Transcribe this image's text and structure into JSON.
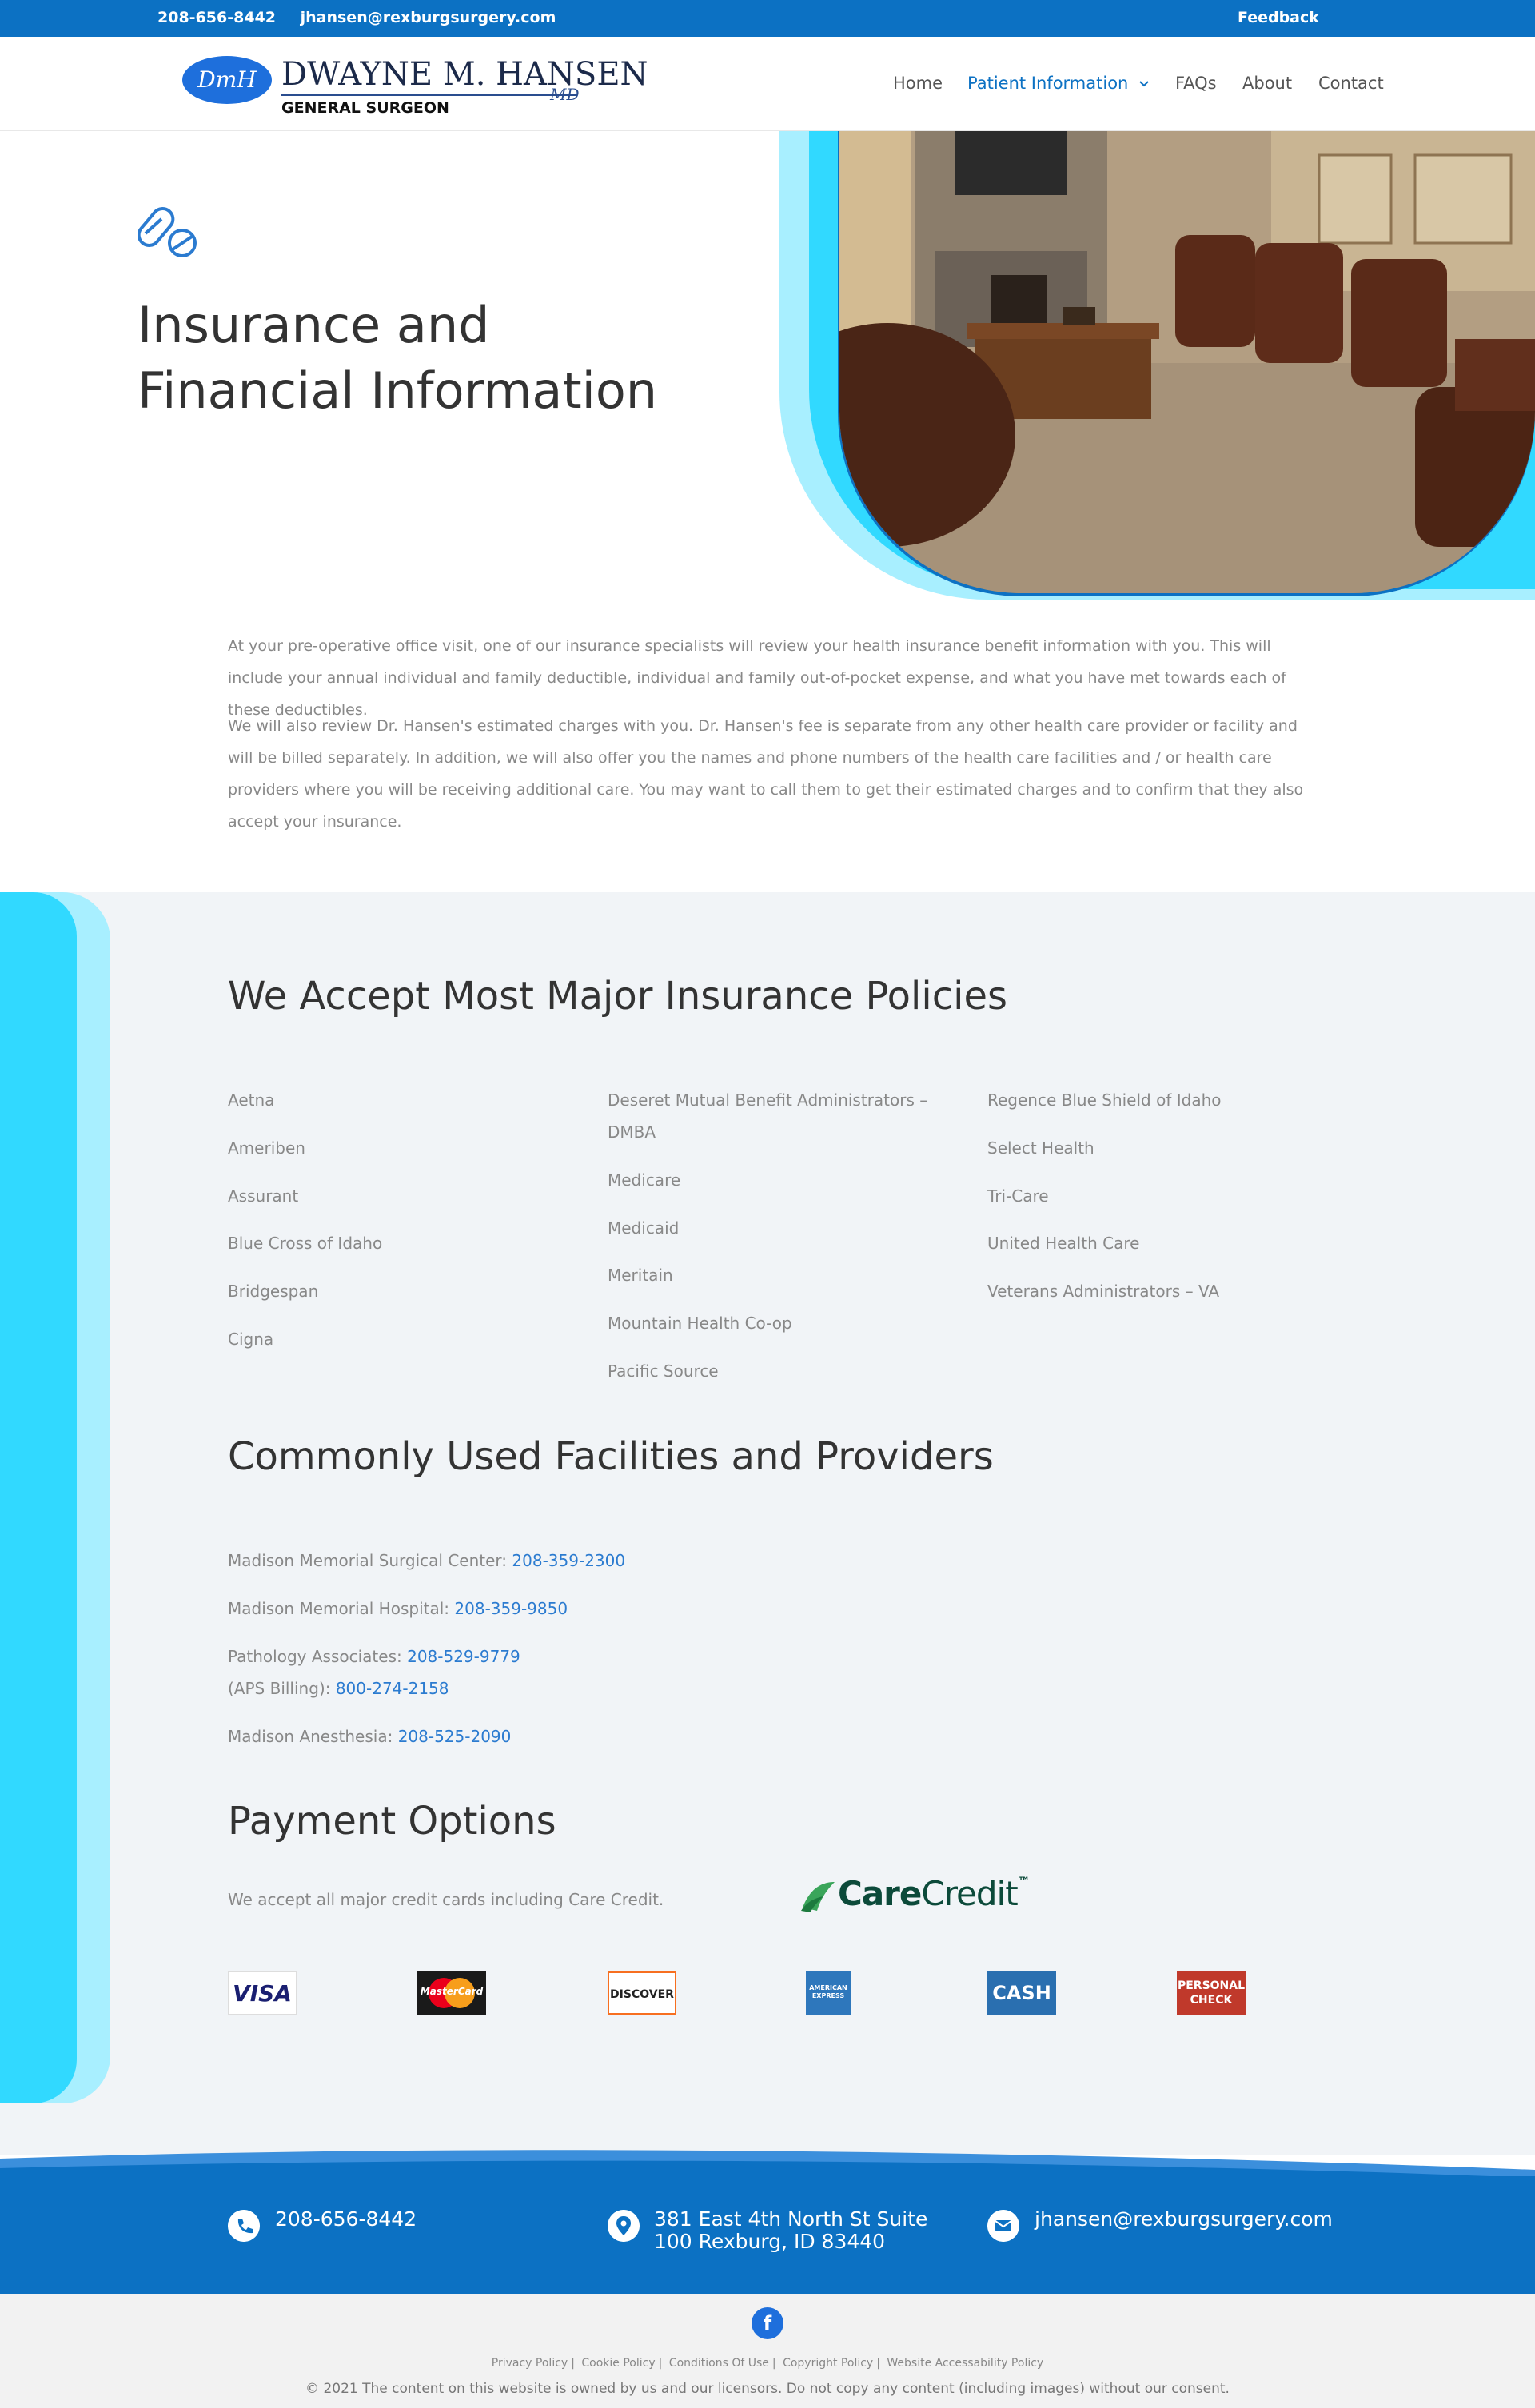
{
  "topbar": {
    "phone": "208-656-8442",
    "email": "jhansen@rexburgsurgery.com",
    "feedback": "Feedback"
  },
  "logo": {
    "monogram": "DmH",
    "name": "DWAYNE M. HANSEN",
    "suffix": "MD",
    "subtitle": "GENERAL SURGEON"
  },
  "nav": [
    {
      "label": "Home",
      "active": false
    },
    {
      "label": "Patient Information",
      "active": true,
      "chevron": "chevron-down-icon"
    },
    {
      "label": "FAQs",
      "active": false
    },
    {
      "label": "About",
      "active": false
    },
    {
      "label": "Contact",
      "active": false
    }
  ],
  "hero": {
    "icon": "pills-icon",
    "title_line1": "Insurance and",
    "title_line2": "Financial Information"
  },
  "intro": {
    "para1": "At your pre-operative office visit, one of our insurance specialists will review your health insurance benefit information with you. This will include your annual individual and family deductible, individual and family out-of-pocket expense, and what you have met towards each of these deductibles.",
    "para2": "We will also review Dr. Hansen's estimated charges with you. Dr. Hansen's fee is separate from any other health care provider or facility and will be billed separately. In addition, we will also offer you the names and phone numbers of the health care facilities and / or health care providers where you will be receiving additional care. You may want to call them to get their estimated charges and to confirm that they also accept your insurance."
  },
  "insurance": {
    "title": "We Accept Most Major Insurance Policies",
    "col1": [
      "Aetna",
      "Ameriben",
      "Assurant",
      "Blue Cross of Idaho",
      "Bridgespan",
      "Cigna"
    ],
    "col2": [
      "Deseret Mutual Benefit Administrators –",
      "DMBA",
      "Medicare",
      "Medicaid",
      "Meritain",
      "Mountain Health Co-op",
      "Pacific Source"
    ],
    "col3": [
      "Regence Blue Shield of Idaho",
      "Select Health",
      "Tri-Care",
      "United Health Care",
      "Veterans Administrators – VA"
    ]
  },
  "facilities": {
    "title": "Commonly Used Facilities and Providers",
    "items": [
      {
        "label": "Madison Memorial Surgical Center: ",
        "phone": "208-359-2300"
      },
      {
        "label": "Madison Memorial Hospital: ",
        "phone": "208-359-9850"
      },
      {
        "label": "Pathology Associates: ",
        "phone": "208-529-9779"
      },
      {
        "label": "(APS Billing): ",
        "phone": "800-274-2158"
      },
      {
        "label": "Madison Anesthesia: ",
        "phone": "208-525-2090"
      }
    ]
  },
  "payment": {
    "title": "Payment Options",
    "text": "We accept all major credit cards including Care Credit.",
    "carecredit_a": "Care",
    "carecredit_b": "Credit",
    "carecredit_tm": "™",
    "cards": [
      {
        "label": "VISA",
        "bg": "#ffffff",
        "fg": "#1a1f71"
      },
      {
        "label": "MasterCard",
        "bg": "#1a1a1a",
        "fg": "#ffffff"
      },
      {
        "label": "DISCOVER",
        "bg": "#ffffff",
        "fg": "#222222"
      },
      {
        "label": "AMERICAN EXPRESS",
        "bg": "#2e77bc",
        "fg": "#ffffff"
      },
      {
        "label": "CASH",
        "bg": "#2a6fb0",
        "fg": "#ffffff"
      },
      {
        "label": "PERSONAL CHECK",
        "bg": "#c0392b",
        "fg": "#ffffff"
      }
    ]
  },
  "footer": {
    "phone": "208-656-8442",
    "address_line1": "381 East 4th North St Suite",
    "address_line2": "100 Rexburg, ID 83440",
    "email": "jhansen@rexburgsurgery.com",
    "facebook": "f",
    "links": [
      "Privacy Policy",
      "Cookie Policy",
      "Conditions Of Use",
      "Copyright Policy",
      "Website Accessability Policy"
    ],
    "copyright": "© 2021 The content on this website is owned by us and our licensors. Do not copy any content (including images) without our consent."
  }
}
